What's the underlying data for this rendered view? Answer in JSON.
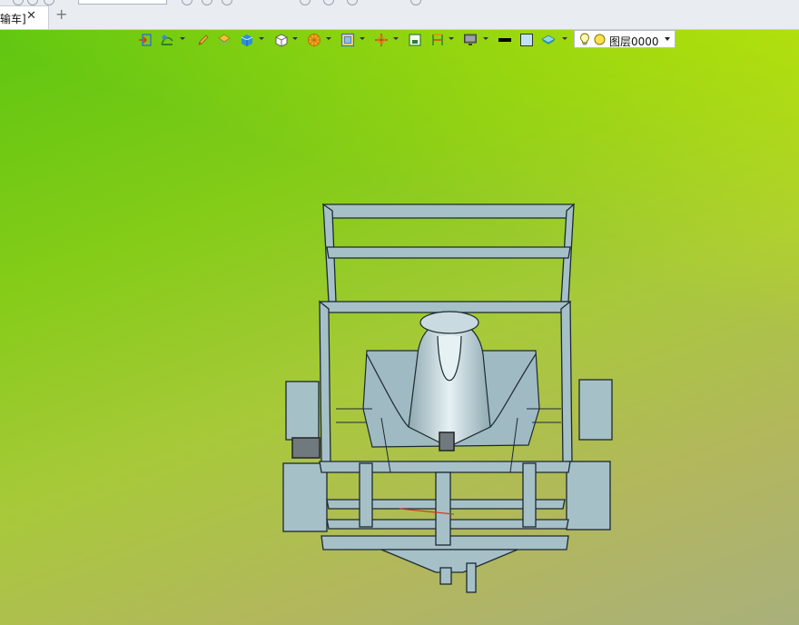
{
  "tabs": [
    {
      "label": "输车]",
      "close_glyph": "✕"
    }
  ],
  "new_tab_glyph": "+",
  "toolbar": {
    "icons": [
      "exit-sketch-icon",
      "curve-filter-icon",
      "pencil-icon",
      "solid-filter-icon",
      "box-render-icon",
      "view-cube-icon",
      "sphere-orange-icon",
      "frame-fit-icon",
      "orient-axis-icon",
      "section-view-icon",
      "dimension-icon",
      "monitor-display-icon",
      "line-color-icon",
      "fill-color-icon",
      "layer-style-icon"
    ],
    "layer": {
      "name": "图层0000",
      "bulb_icon": "light-bulb-icon",
      "dot_icon": "layer-state-icon"
    }
  },
  "colors": {
    "background_top": "#5fc611",
    "background_bottom": "#a9b07b",
    "model_fill": "#a6c0c8",
    "model_edge": "#1d2a30"
  }
}
